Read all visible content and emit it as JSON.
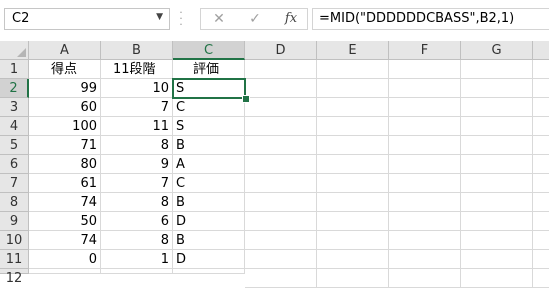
{
  "name_box": {
    "value": "C2"
  },
  "formula_bar": {
    "cancel_icon": "✕",
    "enter_icon": "✓",
    "function_icon": "fx",
    "formula": "=MID(\"DDDDDDCBASS\",B2,1)"
  },
  "columns": [
    "A",
    "B",
    "C",
    "D",
    "E",
    "F",
    "G"
  ],
  "rows": [
    "1",
    "2",
    "3",
    "4",
    "5",
    "6",
    "7",
    "8",
    "9",
    "10",
    "11",
    "12"
  ],
  "headers": {
    "a": "得点",
    "b": "11段階",
    "c": "評価"
  },
  "data": [
    {
      "a": "99",
      "b": "10",
      "c": "S"
    },
    {
      "a": "60",
      "b": "7",
      "c": "C"
    },
    {
      "a": "100",
      "b": "11",
      "c": "S"
    },
    {
      "a": "71",
      "b": "8",
      "c": "B"
    },
    {
      "a": "80",
      "b": "9",
      "c": "A"
    },
    {
      "a": "61",
      "b": "7",
      "c": "C"
    },
    {
      "a": "74",
      "b": "8",
      "c": "B"
    },
    {
      "a": "50",
      "b": "6",
      "c": "D"
    },
    {
      "a": "74",
      "b": "8",
      "c": "B"
    },
    {
      "a": "0",
      "b": "1",
      "c": "D"
    }
  ],
  "colors": {
    "accent": "#217346",
    "header_bg": "#e6e6e6",
    "gridline": "#d9d9d9"
  }
}
